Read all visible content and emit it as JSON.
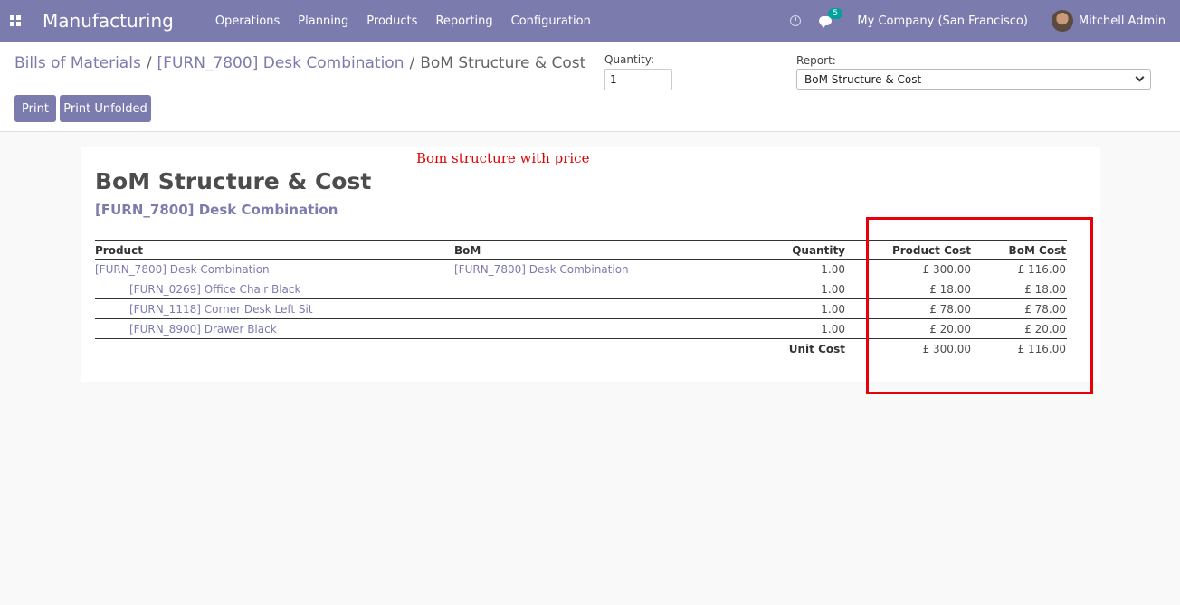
{
  "navbar": {
    "app_title": "Manufacturing",
    "menu": [
      "Operations",
      "Planning",
      "Products",
      "Reporting",
      "Configuration"
    ],
    "message_count": "5",
    "company": "My Company (San Francisco)",
    "user": "Mitchell Admin"
  },
  "breadcrumb": {
    "items": [
      "Bills of Materials",
      "[FURN_7800] Desk Combination",
      "BoM Structure & Cost"
    ],
    "separator": "/"
  },
  "buttons": {
    "print": "Print",
    "print_unfolded": "Print Unfolded"
  },
  "quantity": {
    "label": "Quantity:",
    "value": "1"
  },
  "report": {
    "label": "Report:",
    "selected": "BoM Structure & Cost"
  },
  "annotation": "Bom structure with price",
  "report_body": {
    "title": "BoM Structure & Cost",
    "subtitle": "[FURN_7800] Desk Combination",
    "columns": {
      "product": "Product",
      "bom": "BoM",
      "quantity": "Quantity",
      "product_cost": "Product Cost",
      "bom_cost": "BoM Cost"
    },
    "rows": [
      {
        "product": "[FURN_7800] Desk Combination",
        "bom": "[FURN_7800] Desk Combination",
        "quantity": "1.00",
        "product_cost": "£ 300.00",
        "bom_cost": "£ 116.00"
      },
      {
        "product": "[FURN_0269] Office Chair Black",
        "bom": "",
        "quantity": "1.00",
        "product_cost": "£ 18.00",
        "bom_cost": "£ 18.00"
      },
      {
        "product": "[FURN_1118] Corner Desk Left Sit",
        "bom": "",
        "quantity": "1.00",
        "product_cost": "£ 78.00",
        "bom_cost": "£ 78.00"
      },
      {
        "product": "[FURN_8900] Drawer Black",
        "bom": "",
        "quantity": "1.00",
        "product_cost": "£ 20.00",
        "bom_cost": "£ 20.00"
      }
    ],
    "total": {
      "label": "Unit Cost",
      "product_cost": "£ 300.00",
      "bom_cost": "£ 116.00"
    }
  },
  "colors": {
    "navbar": "#7c7bad",
    "link": "#7c7bad",
    "highlight": "#e8000b"
  }
}
